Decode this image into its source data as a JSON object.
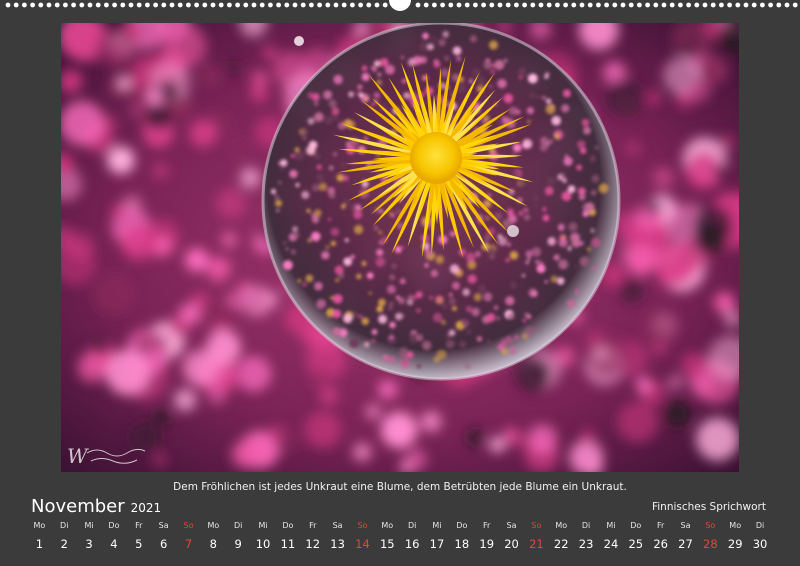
{
  "calendar": {
    "month": "November",
    "year": "2021",
    "quote": "Dem Fröhlichen ist jedes Unkraut eine Blume, dem Betrübten jede Blume ein Unkraut.",
    "source": "Finnisches Sprichwort",
    "weekdays": [
      "Mo",
      "Di",
      "Mi",
      "Do",
      "Fr",
      "Sa",
      "So",
      "Mo",
      "Di",
      "Mi",
      "Do",
      "Fr",
      "Sa",
      "So",
      "Mo",
      "Di",
      "Mi",
      "Do",
      "Fr",
      "Sa",
      "So",
      "Mo",
      "Di",
      "Mi",
      "Do",
      "Fr",
      "Sa",
      "So",
      "Mo",
      "Di"
    ],
    "days": [
      "1",
      "2",
      "3",
      "4",
      "5",
      "6",
      "7",
      "8",
      "9",
      "10",
      "11",
      "12",
      "13",
      "14",
      "15",
      "16",
      "17",
      "18",
      "19",
      "20",
      "21",
      "22",
      "23",
      "24",
      "25",
      "26",
      "27",
      "28",
      "29",
      "30"
    ],
    "sunday_days": [
      7,
      14,
      21,
      28
    ],
    "colors": {
      "background": "#3b3b3b",
      "sunday": "#e0483a",
      "text": "#ffffff"
    }
  },
  "photo": {
    "subject": "yellow dandelion inside glass ball on pink heather"
  }
}
